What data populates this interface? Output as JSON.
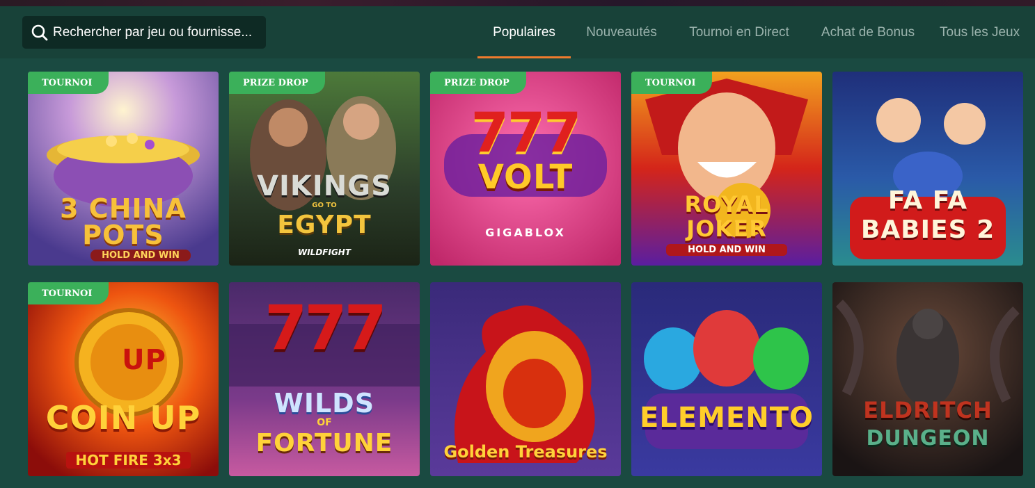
{
  "search": {
    "placeholder": "Rechercher par jeu ou fournisse..."
  },
  "tabs": [
    {
      "label": "Populaires",
      "active": true
    },
    {
      "label": "Nouveautés",
      "active": false
    },
    {
      "label": "Tournoi en Direct",
      "active": false
    },
    {
      "label": "Achat de Bonus",
      "active": false
    },
    {
      "label": "Tous les Jeux",
      "active": false
    }
  ],
  "colors": {
    "accent": "#f07b2d",
    "badge": "#3bb05a",
    "background": "#1a4a41",
    "header": "#184239"
  },
  "games": [
    {
      "badge": "TOURNOI",
      "title": "3 CHINA POTS",
      "subtitle": "HOLD AND WIN"
    },
    {
      "badge": "PRIZE DROP",
      "title": "VIKINGS",
      "middle": "GO TO",
      "title2": "EGYPT",
      "subtitle": "WILDFIGHT"
    },
    {
      "badge": "PRIZE DROP",
      "title": "777",
      "title2": "VOLT",
      "subtitle": "GIGABLOX"
    },
    {
      "badge": "TOURNOI",
      "title": "ROYAL",
      "title2": "JOKER",
      "subtitle": "HOLD AND WIN"
    },
    {
      "badge": "",
      "title": "FA FA",
      "title2": "BABIES 2"
    },
    {
      "badge": "TOURNOI",
      "title": "UP",
      "title2": "COIN UP",
      "subtitle": "HOT FIRE 3x3"
    },
    {
      "badge": "",
      "title": "777",
      "title2": "WILDS",
      "middle": "OF",
      "subtitle": "FORTUNE"
    },
    {
      "badge": "",
      "title": "Golden Treasures"
    },
    {
      "badge": "",
      "title": "ELEMENTO"
    },
    {
      "badge": "",
      "title": "ELDRITCH",
      "title2": "DUNGEON"
    }
  ]
}
